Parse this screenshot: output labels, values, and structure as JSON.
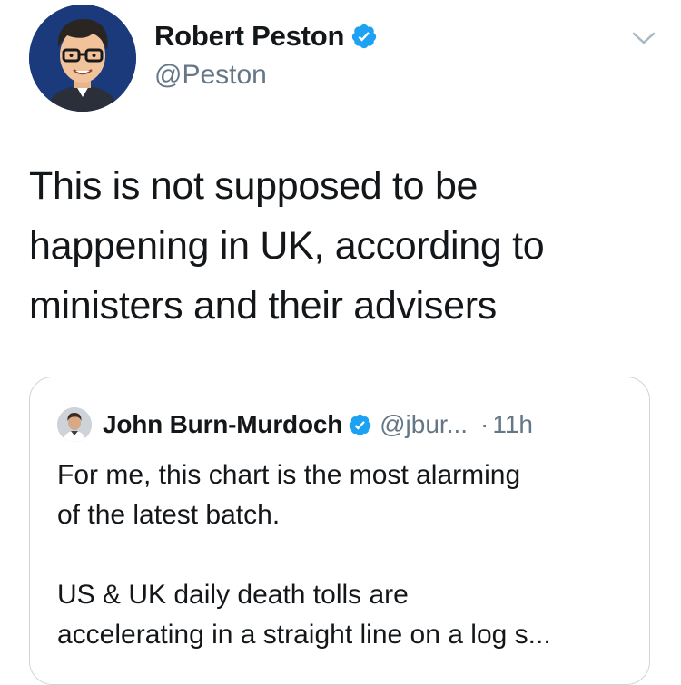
{
  "tweet": {
    "author": {
      "name": "Robert Peston",
      "handle": "@Peston",
      "verified": true,
      "avatar_icon": "cartoon-portrait-avatar"
    },
    "menu_icon": "chevron-down-icon",
    "text": "This is not supposed to be\nhappening in UK, according to\nministers and their advisers",
    "quoted_tweet": {
      "author_name": "John Burn-Murdoch",
      "handle": "@jbur...",
      "separator": "·",
      "time": "11h",
      "verified": true,
      "text": "For me, this chart is the most alarming\nof the latest batch.\n\nUS & UK daily death tolls are\naccelerating in a straight line on a log s..."
    }
  },
  "colors": {
    "verified_blue": "#1da1f2",
    "secondary_text": "#657786",
    "primary_text": "#14171a",
    "card_border": "#ccd6dd"
  }
}
